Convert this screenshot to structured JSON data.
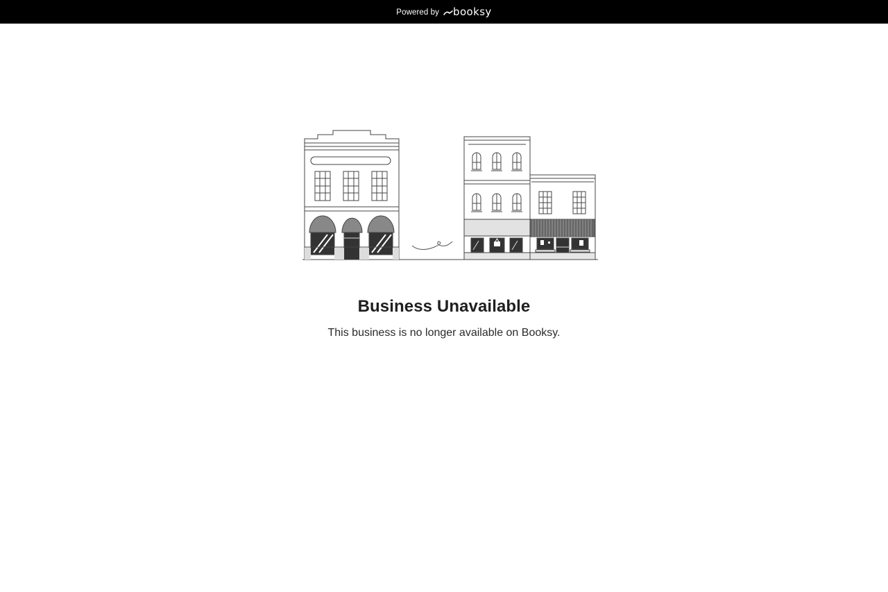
{
  "header": {
    "powered_by": "Powered by",
    "brand_name": "booksy"
  },
  "main": {
    "title": "Business Unavailable",
    "message": "This business is no longer available on Booksy."
  },
  "colors": {
    "header_bg": "#000000",
    "text_dark": "#1f1f1f",
    "illustration_stroke": "#444444",
    "illustration_dark": "#333333"
  },
  "icons": {
    "illustration": "storefronts-illustration",
    "brand": "booksy-logo"
  }
}
